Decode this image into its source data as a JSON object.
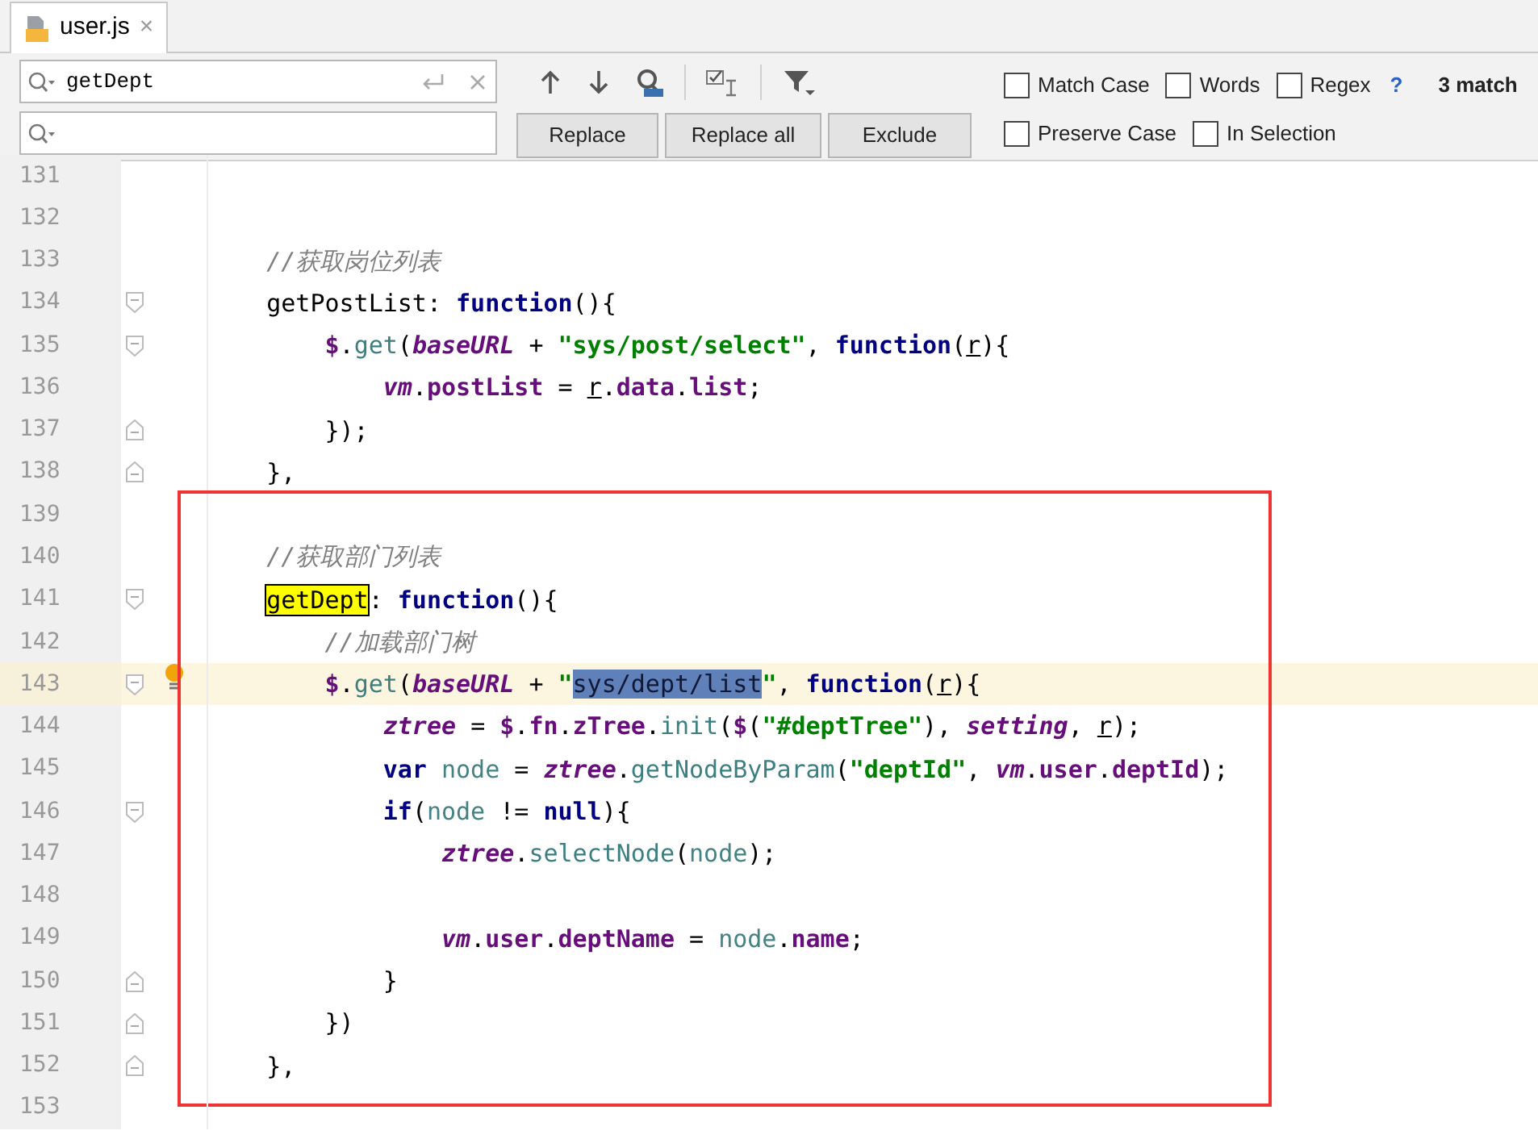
{
  "tabs": [
    {
      "label": "user.js",
      "selected": true,
      "close": "×"
    }
  ],
  "find_bar": {
    "search": {
      "value": "getDept"
    },
    "buttons": [
      "Replace",
      "Replace all",
      "Exclude"
    ],
    "options": [
      {
        "label": "Match Case",
        "checked": false
      },
      {
        "label": "Words",
        "checked": false
      },
      {
        "label": "Regex",
        "checked": false
      },
      {
        "label": "Preserve Case",
        "checked": false
      },
      {
        "label": "In Selection",
        "checked": false
      }
    ],
    "help": "?",
    "match_count": "3 match"
  },
  "editor": {
    "groups": [
      {
        "framed": false,
        "lines": [
          {
            "number": "131",
            "current": false,
            "fold_start": false,
            "fold_end": false
          },
          {
            "number": "132",
            "current": false,
            "fold_start": false,
            "fold_end": false
          },
          {
            "number": "133",
            "current": false,
            "fold_start": false,
            "fold_end": false,
            "tokens": [
              {
                "text": "    //获取岗位列表",
                "kind": "comment"
              }
            ]
          },
          {
            "number": "134",
            "current": false,
            "fold_start": true,
            "fold_end": false,
            "tokens": [
              {
                "text": "    getPostList: ",
                "kind": "plain"
              },
              {
                "text": "function",
                "kind": "kw"
              },
              {
                "text": "(){",
                "kind": "plain"
              }
            ]
          },
          {
            "number": "135",
            "current": false,
            "fold_start": true,
            "fold_end": false,
            "tokens": [
              {
                "text": "        $",
                "kind": "gvar"
              },
              {
                "text": ".",
                "kind": "plain"
              },
              {
                "text": "get",
                "kind": "fn"
              },
              {
                "text": "(",
                "kind": "plain"
              },
              {
                "text": "baseURL",
                "kind": "ivar"
              },
              {
                "text": " + ",
                "kind": "plain"
              },
              {
                "text": "\"sys/post/select\"",
                "kind": "str"
              },
              {
                "text": ", ",
                "kind": "plain"
              },
              {
                "text": "function",
                "kind": "kw"
              },
              {
                "text": "(",
                "kind": "plain"
              },
              {
                "text": "r",
                "kind": "param"
              },
              {
                "text": "){",
                "kind": "plain"
              }
            ]
          },
          {
            "number": "136",
            "current": false,
            "fold_start": false,
            "fold_end": false,
            "tokens": [
              {
                "text": "            vm",
                "kind": "ivar"
              },
              {
                "text": ".",
                "kind": "plain"
              },
              {
                "text": "postList",
                "kind": "prop"
              },
              {
                "text": " = ",
                "kind": "plain"
              },
              {
                "text": "r",
                "kind": "param"
              },
              {
                "text": ".",
                "kind": "plain"
              },
              {
                "text": "data",
                "kind": "prop"
              },
              {
                "text": ".",
                "kind": "plain"
              },
              {
                "text": "list",
                "kind": "prop"
              },
              {
                "text": ";",
                "kind": "plain"
              }
            ]
          },
          {
            "number": "137",
            "current": false,
            "fold_start": false,
            "fold_end": true,
            "tokens": [
              {
                "text": "        });",
                "kind": "plain"
              }
            ]
          },
          {
            "number": "138",
            "current": false,
            "fold_start": false,
            "fold_end": true,
            "tokens": [
              {
                "text": "    },",
                "kind": "plain"
              }
            ]
          }
        ]
      },
      {
        "framed": true,
        "lines": [
          {
            "number": "139",
            "current": false,
            "fold_start": false,
            "fold_end": false
          },
          {
            "number": "140",
            "current": false,
            "fold_start": false,
            "fold_end": false,
            "tokens": [
              {
                "text": "    //获取部门列表",
                "kind": "comment"
              }
            ]
          },
          {
            "number": "141",
            "current": false,
            "fold_start": true,
            "fold_end": false,
            "tokens": [
              {
                "text": "    getDept",
                "kind": "match"
              },
              {
                "text": ": ",
                "kind": "plain"
              },
              {
                "text": "function",
                "kind": "kw"
              },
              {
                "text": "(){",
                "kind": "plain"
              }
            ]
          },
          {
            "number": "142",
            "current": false,
            "fold_start": false,
            "fold_end": false,
            "tokens": [
              {
                "text": "        //加载部门树",
                "kind": "comment"
              }
            ]
          },
          {
            "number": "143",
            "current": true,
            "fold_start": true,
            "fold_end": false,
            "tokens": [
              {
                "text": "        $",
                "kind": "gvar"
              },
              {
                "text": ".",
                "kind": "plain"
              },
              {
                "text": "get",
                "kind": "fn"
              },
              {
                "text": "(",
                "kind": "plain"
              },
              {
                "text": "baseURL",
                "kind": "ivar"
              },
              {
                "text": " + ",
                "kind": "plain"
              },
              {
                "text": "\"",
                "kind": "str"
              },
              {
                "text": "sys/dept/list",
                "kind": "sel"
              },
              {
                "text": "\"",
                "kind": "str"
              },
              {
                "text": ", ",
                "kind": "plain"
              },
              {
                "text": "function",
                "kind": "kw"
              },
              {
                "text": "(",
                "kind": "plain"
              },
              {
                "text": "r",
                "kind": "param"
              },
              {
                "text": "){",
                "kind": "plain"
              }
            ]
          },
          {
            "number": "144",
            "current": false,
            "fold_start": false,
            "fold_end": false,
            "tokens": [
              {
                "text": "            ztree",
                "kind": "ivar"
              },
              {
                "text": " = ",
                "kind": "plain"
              },
              {
                "text": "$",
                "kind": "gvar"
              },
              {
                "text": ".",
                "kind": "plain"
              },
              {
                "text": "fn",
                "kind": "prop"
              },
              {
                "text": ".",
                "kind": "plain"
              },
              {
                "text": "zTree",
                "kind": "prop"
              },
              {
                "text": ".",
                "kind": "plain"
              },
              {
                "text": "init",
                "kind": "fn"
              },
              {
                "text": "(",
                "kind": "plain"
              },
              {
                "text": "$",
                "kind": "gvar"
              },
              {
                "text": "(",
                "kind": "plain"
              },
              {
                "text": "\"#deptTree\"",
                "kind": "str"
              },
              {
                "text": "), ",
                "kind": "plain"
              },
              {
                "text": "setting",
                "kind": "ivar"
              },
              {
                "text": ", ",
                "kind": "plain"
              },
              {
                "text": "r",
                "kind": "param"
              },
              {
                "text": ");",
                "kind": "plain"
              }
            ]
          },
          {
            "number": "145",
            "current": false,
            "fold_start": false,
            "fold_end": false,
            "tokens": [
              {
                "text": "            var",
                "kind": "kw"
              },
              {
                "text": " node",
                "kind": "local"
              },
              {
                "text": " = ",
                "kind": "plain"
              },
              {
                "text": "ztree",
                "kind": "ivar"
              },
              {
                "text": ".",
                "kind": "plain"
              },
              {
                "text": "getNodeByParam",
                "kind": "fn"
              },
              {
                "text": "(",
                "kind": "plain"
              },
              {
                "text": "\"deptId\"",
                "kind": "str"
              },
              {
                "text": ", ",
                "kind": "plain"
              },
              {
                "text": "vm",
                "kind": "ivar"
              },
              {
                "text": ".",
                "kind": "plain"
              },
              {
                "text": "user",
                "kind": "prop"
              },
              {
                "text": ".",
                "kind": "plain"
              },
              {
                "text": "deptId",
                "kind": "prop"
              },
              {
                "text": ");",
                "kind": "plain"
              }
            ]
          },
          {
            "number": "146",
            "current": false,
            "fold_start": true,
            "fold_end": false,
            "tokens": [
              {
                "text": "            if",
                "kind": "kw"
              },
              {
                "text": "(",
                "kind": "plain"
              },
              {
                "text": "node",
                "kind": "local"
              },
              {
                "text": " != ",
                "kind": "plain"
              },
              {
                "text": "null",
                "kind": "kw"
              },
              {
                "text": "){",
                "kind": "plain"
              }
            ]
          },
          {
            "number": "147",
            "current": false,
            "fold_start": false,
            "fold_end": false,
            "tokens": [
              {
                "text": "                ztree",
                "kind": "ivar"
              },
              {
                "text": ".",
                "kind": "plain"
              },
              {
                "text": "selectNode",
                "kind": "fn"
              },
              {
                "text": "(",
                "kind": "plain"
              },
              {
                "text": "node",
                "kind": "local"
              },
              {
                "text": ");",
                "kind": "plain"
              }
            ]
          },
          {
            "number": "148",
            "current": false,
            "fold_start": false,
            "fold_end": false
          },
          {
            "number": "149",
            "current": false,
            "fold_start": false,
            "fold_end": false,
            "tokens": [
              {
                "text": "                vm",
                "kind": "ivar"
              },
              {
                "text": ".",
                "kind": "plain"
              },
              {
                "text": "user",
                "kind": "prop"
              },
              {
                "text": ".",
                "kind": "plain"
              },
              {
                "text": "deptName",
                "kind": "prop"
              },
              {
                "text": " = ",
                "kind": "plain"
              },
              {
                "text": "node",
                "kind": "local"
              },
              {
                "text": ".",
                "kind": "plain"
              },
              {
                "text": "name",
                "kind": "prop"
              },
              {
                "text": ";",
                "kind": "plain"
              }
            ]
          },
          {
            "number": "150",
            "current": false,
            "fold_start": false,
            "fold_end": true,
            "tokens": [
              {
                "text": "            }",
                "kind": "plain"
              }
            ]
          },
          {
            "number": "151",
            "current": false,
            "fold_start": false,
            "fold_end": true,
            "tokens": [
              {
                "text": "        })",
                "kind": "plain"
              }
            ]
          },
          {
            "number": "152",
            "current": false,
            "fold_start": false,
            "fold_end": true,
            "tokens": [
              {
                "text": "    },",
                "kind": "plain"
              }
            ]
          }
        ]
      },
      {
        "framed": false,
        "lines": [
          {
            "number": "153",
            "current": false,
            "fold_start": false,
            "fold_end": false
          }
        ]
      }
    ]
  }
}
